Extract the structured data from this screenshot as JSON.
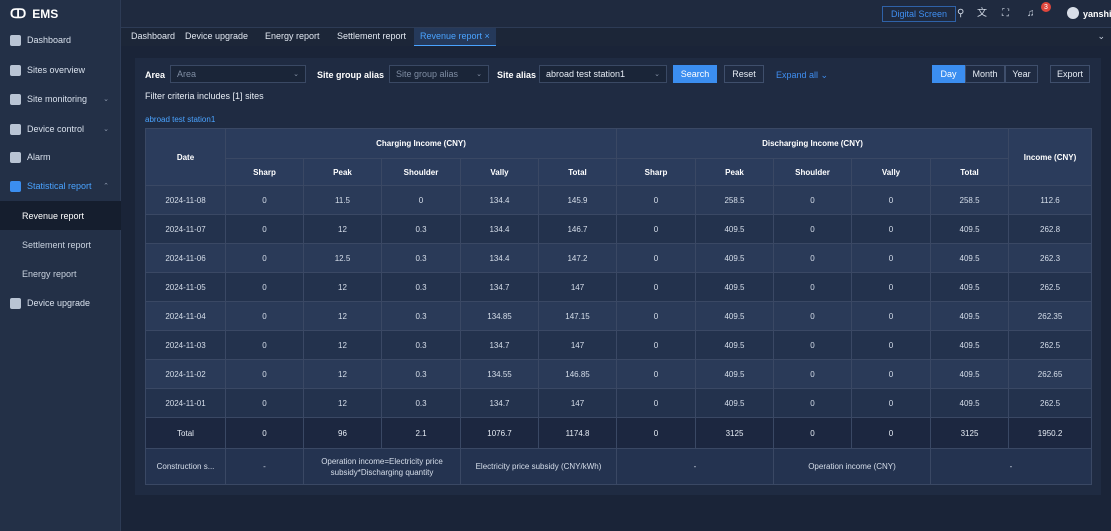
{
  "app": {
    "name": "EMS"
  },
  "sidebar": {
    "items": [
      {
        "label": "Dashboard"
      },
      {
        "label": "Sites overview"
      },
      {
        "label": "Site monitoring"
      },
      {
        "label": "Device control"
      },
      {
        "label": "Alarm"
      },
      {
        "label": "Statistical report"
      },
      {
        "label": "Device upgrade"
      }
    ],
    "sub_items": [
      {
        "label": "Revenue report"
      },
      {
        "label": "Settlement report"
      },
      {
        "label": "Energy report"
      }
    ]
  },
  "topbar": {
    "digital_screen": "Digital Screen",
    "notification_count": "3",
    "username": "yanshi"
  },
  "tabs": [
    {
      "label": "Dashboard"
    },
    {
      "label": "Device upgrade"
    },
    {
      "label": "Energy report"
    },
    {
      "label": "Settlement report"
    },
    {
      "label": "Revenue report ×"
    }
  ],
  "filters": {
    "area_label": "Area",
    "area_placeholder": "Area",
    "group_label": "Site group alias",
    "group_placeholder": "Site group alias",
    "alias_label": "Site alias",
    "alias_value": "abroad test station1",
    "search": "Search",
    "reset": "Reset",
    "expand": "Expand all ⌄",
    "periods": [
      "Day",
      "Month",
      "Year"
    ],
    "export": "Export",
    "criteria_prefix": "Filter criteria includes",
    "criteria_count": "[1]",
    "criteria_suffix": "sites",
    "station_name": "abroad test station1"
  },
  "table": {
    "date_header": "Date",
    "charging_header": "Charging Income (CNY)",
    "discharging_header": "Discharging Income (CNY)",
    "income_header": "Income (CNY)",
    "sub_headers": [
      "Sharp",
      "Peak",
      "Shoulder",
      "Vally",
      "Total"
    ],
    "rows": [
      [
        "2024-11-08",
        "0",
        "11.5",
        "0",
        "134.4",
        "145.9",
        "0",
        "258.5",
        "0",
        "0",
        "258.5",
        "112.6"
      ],
      [
        "2024-11-07",
        "0",
        "12",
        "0.3",
        "134.4",
        "146.7",
        "0",
        "409.5",
        "0",
        "0",
        "409.5",
        "262.8"
      ],
      [
        "2024-11-06",
        "0",
        "12.5",
        "0.3",
        "134.4",
        "147.2",
        "0",
        "409.5",
        "0",
        "0",
        "409.5",
        "262.3"
      ],
      [
        "2024-11-05",
        "0",
        "12",
        "0.3",
        "134.7",
        "147",
        "0",
        "409.5",
        "0",
        "0",
        "409.5",
        "262.5"
      ],
      [
        "2024-11-04",
        "0",
        "12",
        "0.3",
        "134.85",
        "147.15",
        "0",
        "409.5",
        "0",
        "0",
        "409.5",
        "262.35"
      ],
      [
        "2024-11-03",
        "0",
        "12",
        "0.3",
        "134.7",
        "147",
        "0",
        "409.5",
        "0",
        "0",
        "409.5",
        "262.5"
      ],
      [
        "2024-11-02",
        "0",
        "12",
        "0.3",
        "134.55",
        "146.85",
        "0",
        "409.5",
        "0",
        "0",
        "409.5",
        "262.65"
      ],
      [
        "2024-11-01",
        "0",
        "12",
        "0.3",
        "134.7",
        "147",
        "0",
        "409.5",
        "0",
        "0",
        "409.5",
        "262.5"
      ]
    ],
    "total_row": [
      "Total",
      "0",
      "96",
      "2.1",
      "1076.7",
      "1174.8",
      "0",
      "3125",
      "0",
      "0",
      "3125",
      "1950.2"
    ],
    "footer": {
      "construction": "Construction s...",
      "dash1": "-",
      "formula_line1": "Operation income=Electricity price",
      "formula_line2": "subsidy*Discharging quantity",
      "subsidy": "Electricity price subsidy (CNY/kWh)",
      "dash2": "-",
      "operation_income": "Operation income (CNY)",
      "dash3": "-"
    }
  }
}
